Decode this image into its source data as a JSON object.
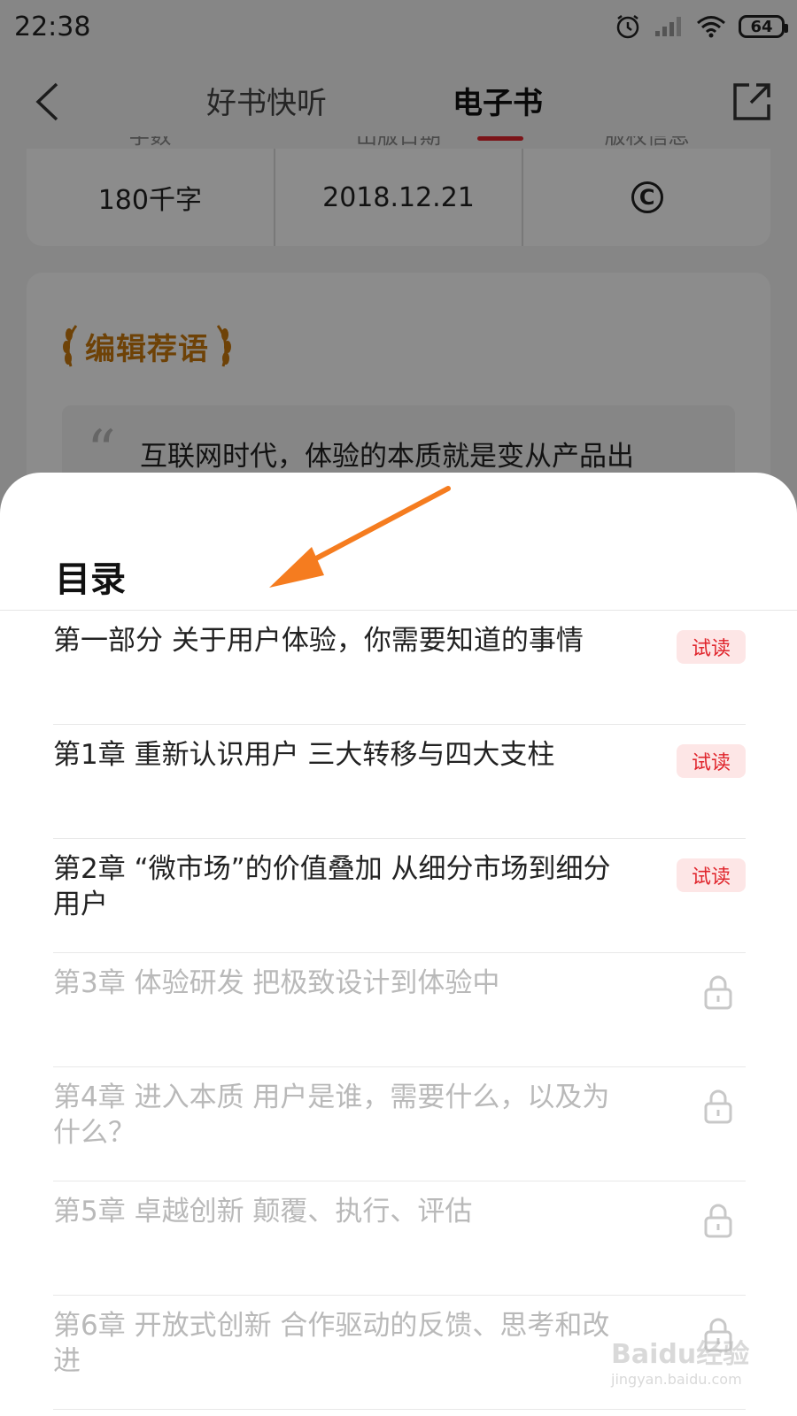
{
  "status_bar": {
    "time": "22:38",
    "battery": "64",
    "icons": [
      "alarm-icon",
      "signal-icon",
      "wifi-icon",
      "battery-icon"
    ]
  },
  "nav": {
    "tabs": [
      "好书快听",
      "电子书"
    ],
    "active_tab": "电子书",
    "back_icon": "back-arrow-icon",
    "share_icon": "share-icon"
  },
  "book_info": {
    "cells": [
      {
        "label": "字数",
        "value": "180千字"
      },
      {
        "label": "出版日期",
        "value": "2018.12.21"
      },
      {
        "label": "版权信息",
        "value": "©"
      }
    ]
  },
  "editor": {
    "title": "编辑荐语",
    "quote": "互联网时代，体验的本质就是变从产品出"
  },
  "toc": {
    "title": "目录",
    "trial_label": "试读",
    "items": [
      {
        "text": "第一部分 关于用户体验，你需要知道的事情",
        "status": "trial"
      },
      {
        "text": "第1章 重新认识用户 三大转移与四大支柱",
        "status": "trial"
      },
      {
        "text": "第2章 “微市场”的价值叠加 从细分市场到细分用户",
        "status": "trial"
      },
      {
        "text": "第3章 体验研发 把极致设计到体验中",
        "status": "locked"
      },
      {
        "text": "第4章 进入本质 用户是谁，需要什么，以及为什么？",
        "status": "locked"
      },
      {
        "text": "第5章 卓越创新 颠覆、执行、评估",
        "status": "locked"
      },
      {
        "text": "第6章 开放式创新 合作驱动的反馈、思考和改进",
        "status": "locked"
      }
    ]
  },
  "colors": {
    "accent": "#e0262d",
    "annotation_arrow": "#f57c1f",
    "editor_title": "#c8780e"
  },
  "watermark": {
    "logo": "Baidu经验",
    "url": "jingyan.baidu.com"
  }
}
